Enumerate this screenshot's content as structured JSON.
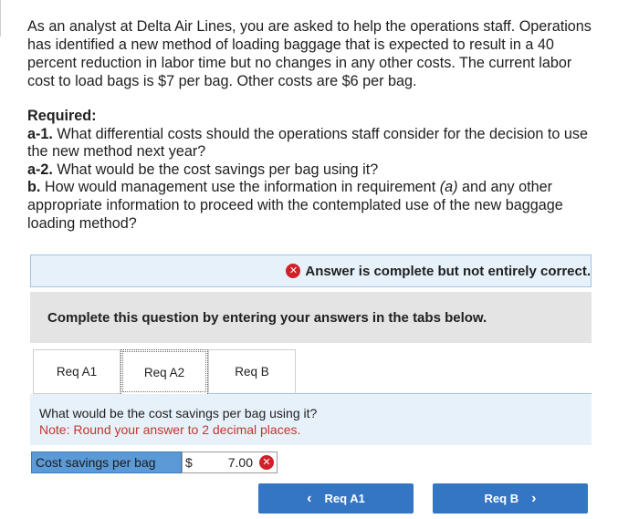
{
  "intro": "As an analyst at Delta Air Lines, you are asked to help the operations staff. Operations has identified a new method of loading baggage that is expected to result in a 40 percent reduction in labor time but no changes in any other costs. The current labor cost to load bags is $7 per bag. Other costs are $6 per bag.",
  "required": {
    "heading": "Required:",
    "a1_label": "a-1.",
    "a1_text": " What differential costs should the operations staff consider for the decision to use the new method next year?",
    "a2_label": "a-2.",
    "a2_text": " What would be the cost savings per bag using it?",
    "b_label": "b.",
    "b_text_1": " How would management use the information in requirement ",
    "b_text_em": "(a)",
    "b_text_2": " and any other appropriate information to proceed with the contemplated use of the new baggage loading method?"
  },
  "status": {
    "icon": "x-circle-icon",
    "text": "Answer is complete but not entirely correct.",
    "color": "#d0202a"
  },
  "instructions": "Complete this question by entering your answers in the tabs below.",
  "tabs": [
    {
      "label": "Req A1"
    },
    {
      "label": "Req A2"
    },
    {
      "label": "Req B"
    }
  ],
  "question": {
    "text": "What would be the cost savings per bag using it?",
    "note": "Note: Round your answer to 2 decimal places."
  },
  "answer": {
    "label": "Cost savings per bag",
    "currency": "$",
    "value": "7.00"
  },
  "nav": {
    "prev_label": "Req A1",
    "next_label": "Req B",
    "prev_icon": "chevron-left-icon",
    "next_icon": "chevron-right-icon",
    "accent": "#3475c4"
  }
}
